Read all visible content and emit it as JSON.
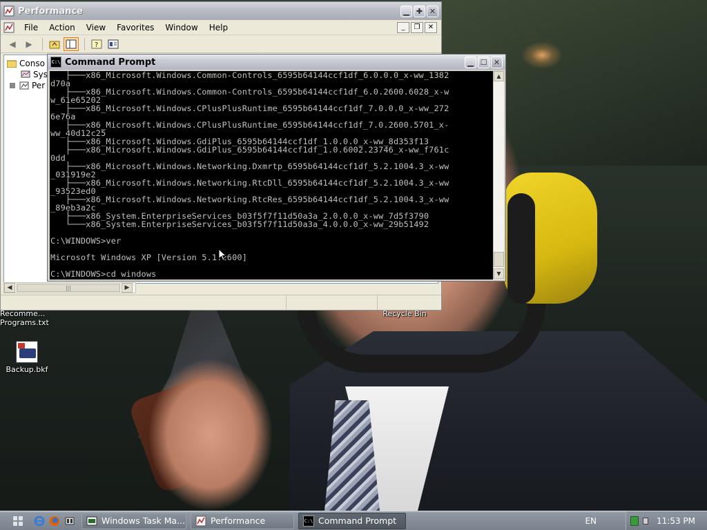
{
  "desktop": {
    "icons": [
      {
        "label_line1": "Recomme...",
        "label_line2": "Programs.txt"
      },
      {
        "label": "Backup.bkf"
      },
      {
        "label": "Recycle Bin"
      }
    ]
  },
  "perf_window": {
    "title": "Performance",
    "menu": [
      "File",
      "Action",
      "View",
      "Favorites",
      "Window",
      "Help"
    ],
    "mdi_buttons": [
      "_",
      "❐",
      "✕"
    ],
    "tree": [
      {
        "label": "Conso"
      },
      {
        "label": "Sys"
      },
      {
        "label": "Per"
      }
    ],
    "hscroll_thumb_glyph": "|||"
  },
  "cmd_window": {
    "title": "Command Prompt",
    "lines": [
      "   ├───x86_Microsoft.Windows.Common-Controls_6595b64144ccf1df_6.0.0.0_x-ww_1382",
      "d70a",
      "   ├───x86_Microsoft.Windows.Common-Controls_6595b64144ccf1df_6.0.2600.6028_x-w",
      "w_61e65202",
      "   ├───x86_Microsoft.Windows.CPlusPlusRuntime_6595b64144ccf1df_7.0.0.0_x-ww_272",
      "6e76a",
      "   ├───x86_Microsoft.Windows.CPlusPlusRuntime_6595b64144ccf1df_7.0.2600.5701_x-",
      "ww_40d12c25",
      "   ├───x86_Microsoft.Windows.GdiPlus_6595b64144ccf1df_1.0.0.0_x-ww_8d353f13",
      "   ├───x86_Microsoft.Windows.GdiPlus_6595b64144ccf1df_1.0.6002.23746_x-ww_f761c",
      "0dd",
      "   ├───x86_Microsoft.Windows.Networking.Dxmrtp_6595b64144ccf1df_5.2.1004.3_x-ww",
      "_031919e2",
      "   ├───x86_Microsoft.Windows.Networking.RtcDll_6595b64144ccf1df_5.2.1004.3_x-ww",
      "_93523ed0",
      "   ├───x86_Microsoft.Windows.Networking.RtcRes_6595b64144ccf1df_5.2.1004.3_x-ww",
      "_89eb3a2c",
      "   ├───x86_System.EnterpriseServices_b03f5f7f11d50a3a_2.0.0.0_x-ww_7d5f3790",
      "   └───x86_System.EnterpriseServices_b03f5f7f11d50a3a_4.0.0.0_x-ww_29b51492",
      "",
      "C:\\WINDOWS>ver",
      "",
      "Microsoft Windows XP [Version 5.1.2600]",
      "",
      "C:\\WINDOWS>cd windows"
    ]
  },
  "taskbar": {
    "tasks": [
      {
        "label": "Windows Task Ma..."
      },
      {
        "label": "Performance"
      },
      {
        "label": "Command Prompt"
      }
    ],
    "language": "EN",
    "clock": "11:53 PM"
  },
  "colors": {
    "console_bg": "#000000",
    "console_fg": "#c0c0c0",
    "taskbar": "#7a838d"
  }
}
